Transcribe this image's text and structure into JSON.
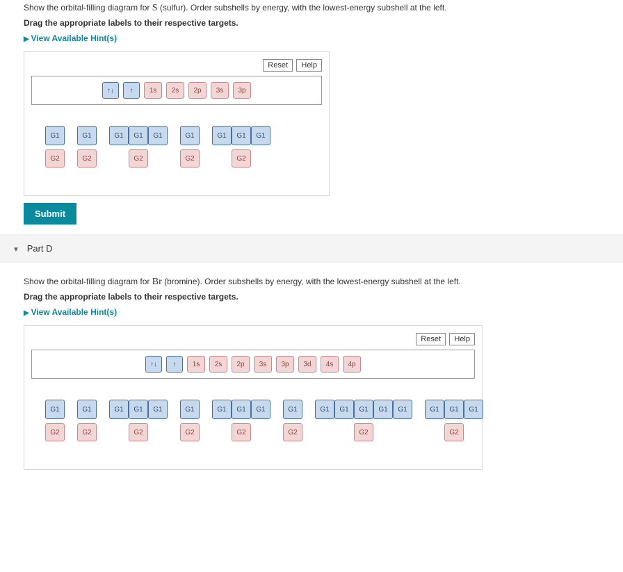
{
  "partC": {
    "prompt_prefix": "Show the orbital-filling diagram for ",
    "symbol": "S",
    "prompt_suffix": " (sulfur). Order subshells by energy, with the lowest-energy subshell at the left.",
    "drag_instruction": "Drag the appropriate labels to their respective targets.",
    "hints_label": "View Available Hint(s)",
    "reset_label": "Reset",
    "help_label": "Help",
    "labels": [
      "↑↓",
      "↑",
      "1s",
      "2s",
      "2p",
      "3s",
      "3p"
    ],
    "groups": [
      {
        "orbitals": [
          "G1"
        ],
        "sublabel": "G2"
      },
      {
        "orbitals": [
          "G1"
        ],
        "sublabel": "G2"
      },
      {
        "orbitals": [
          "G1",
          "G1",
          "G1"
        ],
        "sublabel": "G2"
      },
      {
        "orbitals": [
          "G1"
        ],
        "sublabel": "G2"
      },
      {
        "orbitals": [
          "G1",
          "G1",
          "G1"
        ],
        "sublabel": "G2"
      }
    ],
    "submit_label": "Submit"
  },
  "partD": {
    "heading": "Part D",
    "prompt_prefix": "Show the orbital-filling diagram for ",
    "symbol": "Br",
    "prompt_suffix": " (bromine). Order subshells by energy, with the lowest-energy subshell at the left.",
    "drag_instruction": "Drag the appropriate labels to their respective targets.",
    "hints_label": "View Available Hint(s)",
    "reset_label": "Reset",
    "help_label": "Help",
    "labels": [
      "↑↓",
      "↑",
      "1s",
      "2s",
      "2p",
      "3s",
      "3p",
      "3d",
      "4s",
      "4p"
    ],
    "groups": [
      {
        "orbitals": [
          "G1"
        ],
        "sublabel": "G2"
      },
      {
        "orbitals": [
          "G1"
        ],
        "sublabel": "G2"
      },
      {
        "orbitals": [
          "G1",
          "G1",
          "G1"
        ],
        "sublabel": "G2"
      },
      {
        "orbitals": [
          "G1"
        ],
        "sublabel": "G2"
      },
      {
        "orbitals": [
          "G1",
          "G1",
          "G1"
        ],
        "sublabel": "G2"
      },
      {
        "orbitals": [
          "G1"
        ],
        "sublabel": "G2"
      },
      {
        "orbitals": [
          "G1",
          "G1",
          "G1",
          "G1",
          "G1"
        ],
        "sublabel": "G2"
      },
      {
        "orbitals": [
          "G1",
          "G1",
          "G1"
        ],
        "sublabel": "G2"
      }
    ]
  }
}
